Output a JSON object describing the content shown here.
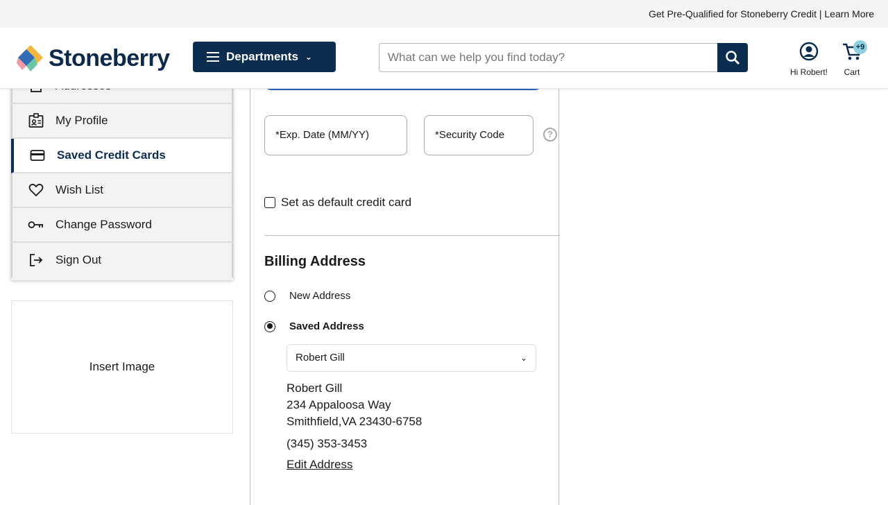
{
  "promo": {
    "text": "Get Pre-Qualified for Stoneberry Credit | Learn More"
  },
  "header": {
    "logo_text": "Stoneberry",
    "departments_label": "Departments",
    "search_placeholder": "What can we help you find today?",
    "account_label": "Hi Robert!",
    "cart_label": "Cart",
    "cart_badge": "+9"
  },
  "sidebar": {
    "items": [
      {
        "label": "Addresses",
        "icon": "address-book-icon"
      },
      {
        "label": "My Profile",
        "icon": "profile-badge-icon"
      },
      {
        "label": "Saved Credit Cards",
        "icon": "credit-card-icon",
        "active": true
      },
      {
        "label": "Wish List",
        "icon": "heart-icon"
      },
      {
        "label": "Change Password",
        "icon": "key-icon"
      },
      {
        "label": "Sign Out",
        "icon": "sign-out-icon"
      }
    ],
    "image_placeholder": "Insert Image"
  },
  "card_form": {
    "exp_date_placeholder": "*Exp. Date (MM/YY)",
    "security_code_placeholder": "*Security Code",
    "default_checkbox_label": "Set as default credit card",
    "default_checked": false
  },
  "billing": {
    "heading": "Billing Address",
    "options": [
      {
        "label": "New Address",
        "selected": false
      },
      {
        "label": "Saved Address",
        "selected": true
      }
    ],
    "saved_select_value": "Robert Gill",
    "address": {
      "name": "Robert Gill",
      "street": "234 Appaloosa Way",
      "city_state_zip": "Smithfield,VA 23430-6758",
      "phone": "(345) 353-3453"
    },
    "edit_label": "Edit Address"
  },
  "colors": {
    "brand_navy": "#0c2d4f",
    "badge": "#8fd0e0",
    "focus_blue": "#2d62c8"
  }
}
